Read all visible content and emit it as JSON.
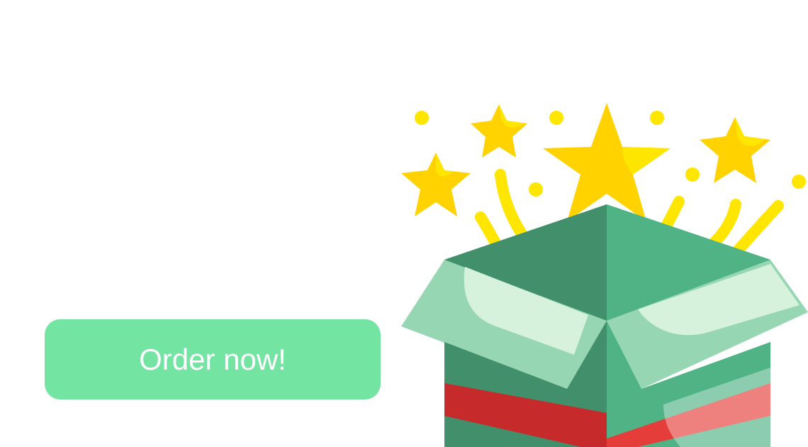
{
  "cta": {
    "label": "Order now!"
  },
  "colors": {
    "button": "#73e4a2",
    "button_text": "#ffffff",
    "box_green_dark": "#41906b",
    "box_green": "#4fb386",
    "box_green_light": "#97d6b2",
    "box_green_pale": "#d6f1dc",
    "ribbon_red_dark": "#c72a2a",
    "ribbon_red": "#e53e3a",
    "star_yellow": "#ffd200",
    "star_highlight": "#ffe600",
    "confetti_yellow": "#ffe600"
  },
  "illustration": {
    "icon": "gift-box-stars-icon"
  }
}
